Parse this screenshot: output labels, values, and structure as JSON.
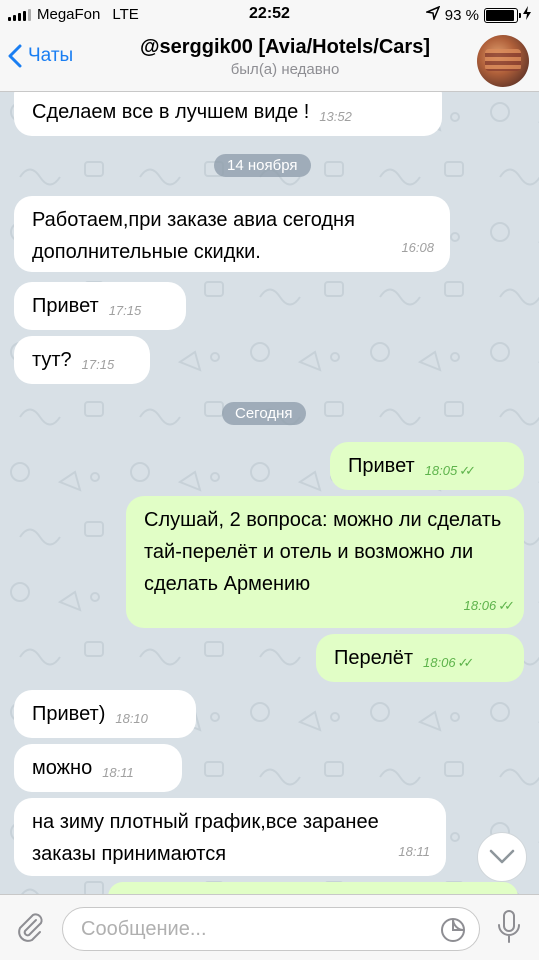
{
  "status_bar": {
    "carrier": "MegaFon",
    "network": "LTE",
    "time": "22:52",
    "battery": "93 %"
  },
  "header": {
    "back_label": "Чаты",
    "title": "@serggik00 [Avia/Hotels/Cars]",
    "subtitle": "был(а) недавно"
  },
  "messages": [
    {
      "text": "Сделаем все в лучшем виде !",
      "time": "13:52"
    },
    {
      "text": "Работаем,при заказе авиа сегодня дополнительные скидки.",
      "time": "16:08"
    },
    {
      "text": "Привет",
      "time": "17:15"
    },
    {
      "text": "тут?",
      "time": "17:15"
    },
    {
      "text": "Привет",
      "time": "18:05"
    },
    {
      "text": "Слушай, 2 вопроса: можно ли сделать тай-перелёт и отель и возможно ли сделать Армению",
      "time": "18:06"
    },
    {
      "text": "Перелёт",
      "time": "18:06"
    },
    {
      "text": "Привет)",
      "time": "18:10"
    },
    {
      "text": "можно",
      "time": "18:11"
    },
    {
      "text": "на зиму плотный график,все заранее заказы принимаются",
      "time": "18:11"
    }
  ],
  "date_separators": [
    "14 ноября",
    "Сегодня"
  ],
  "input": {
    "placeholder": "Сообщение..."
  },
  "colors": {
    "accent": "#1a7ef2",
    "incoming": "#ffffff",
    "outgoing": "#e1fec6",
    "background": "#d8e0e6"
  }
}
